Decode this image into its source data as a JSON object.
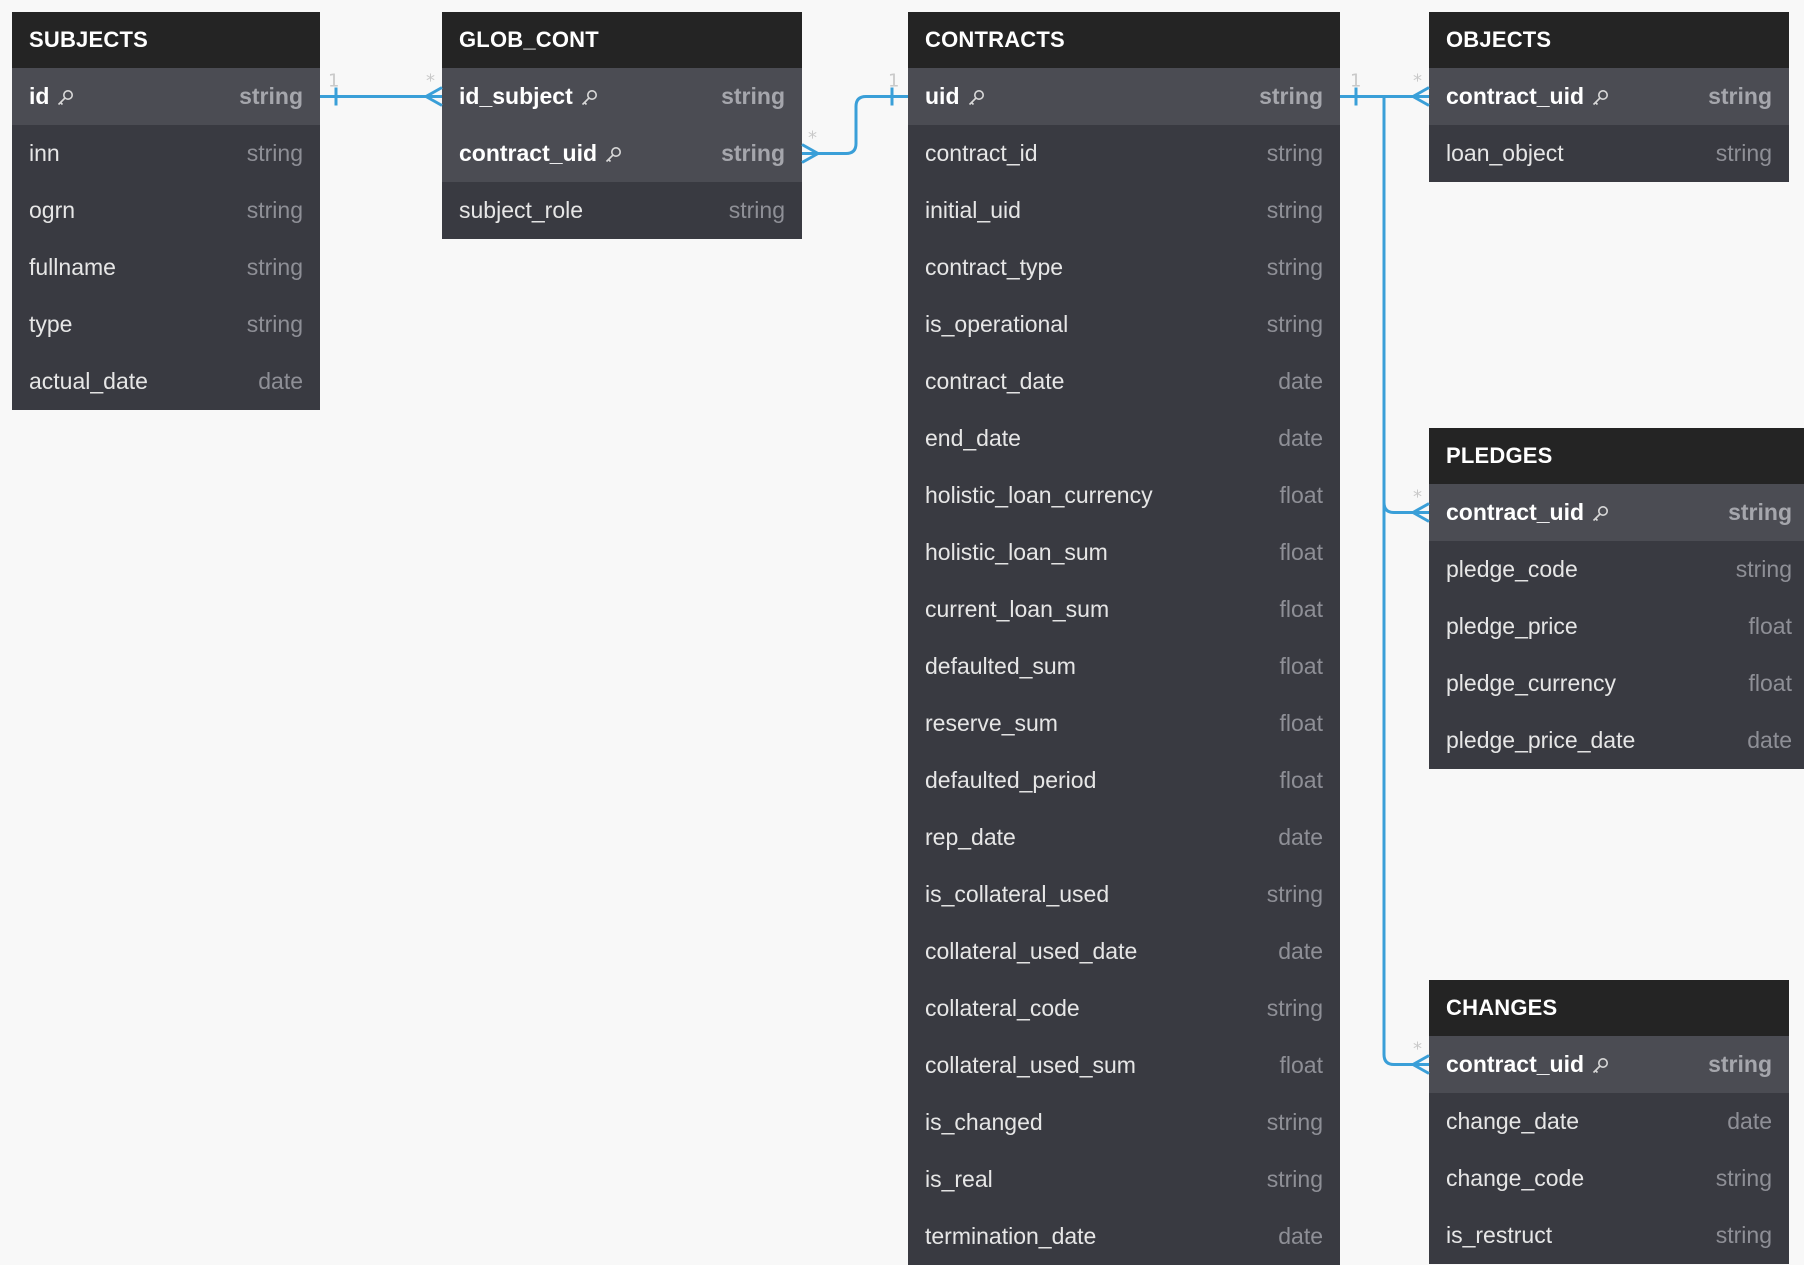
{
  "tables": [
    {
      "id": "subjects",
      "title": "SUBJECTS",
      "fields": [
        {
          "name": "id",
          "type": "string",
          "pk": true
        },
        {
          "name": "inn",
          "type": "string"
        },
        {
          "name": "ogrn",
          "type": "string"
        },
        {
          "name": "fullname",
          "type": "string"
        },
        {
          "name": "type",
          "type": "string"
        },
        {
          "name": "actual_date",
          "type": "date"
        }
      ]
    },
    {
      "id": "glob_cont",
      "title": "GLOB_CONT",
      "fields": [
        {
          "name": "id_subject",
          "type": "string",
          "pk": true
        },
        {
          "name": "contract_uid",
          "type": "string",
          "pk": true
        },
        {
          "name": "subject_role",
          "type": "string"
        }
      ]
    },
    {
      "id": "contracts",
      "title": "CONTRACTS",
      "fields": [
        {
          "name": "uid",
          "type": "string",
          "pk": true
        },
        {
          "name": "contract_id",
          "type": "string"
        },
        {
          "name": "initial_uid",
          "type": "string"
        },
        {
          "name": "contract_type",
          "type": "string"
        },
        {
          "name": "is_operational",
          "type": "string"
        },
        {
          "name": "contract_date",
          "type": "date"
        },
        {
          "name": "end_date",
          "type": "date"
        },
        {
          "name": "holistic_loan_currency",
          "type": "float"
        },
        {
          "name": "holistic_loan_sum",
          "type": "float"
        },
        {
          "name": "current_loan_sum",
          "type": "float"
        },
        {
          "name": "defaulted_sum",
          "type": "float"
        },
        {
          "name": "reserve_sum",
          "type": "float"
        },
        {
          "name": "defaulted_period",
          "type": "float"
        },
        {
          "name": "rep_date",
          "type": "date"
        },
        {
          "name": "is_collateral_used",
          "type": "string"
        },
        {
          "name": "collateral_used_date",
          "type": "date"
        },
        {
          "name": "collateral_code",
          "type": "string"
        },
        {
          "name": "collateral_used_sum",
          "type": "float"
        },
        {
          "name": "is_changed",
          "type": "string"
        },
        {
          "name": "is_real",
          "type": "string"
        },
        {
          "name": "termination_date",
          "type": "date"
        }
      ]
    },
    {
      "id": "objects",
      "title": "OBJECTS",
      "fields": [
        {
          "name": "contract_uid",
          "type": "string",
          "pk": true
        },
        {
          "name": "loan_object",
          "type": "string"
        }
      ]
    },
    {
      "id": "pledges",
      "title": "PLEDGES",
      "fields": [
        {
          "name": "contract_uid",
          "type": "string",
          "pk": true
        },
        {
          "name": "pledge_code",
          "type": "string"
        },
        {
          "name": "pledge_price",
          "type": "float"
        },
        {
          "name": "pledge_currency",
          "type": "float"
        },
        {
          "name": "pledge_price_date",
          "type": "date"
        }
      ]
    },
    {
      "id": "changes",
      "title": "CHANGES",
      "fields": [
        {
          "name": "contract_uid",
          "type": "string",
          "pk": true
        },
        {
          "name": "change_date",
          "type": "date"
        },
        {
          "name": "change_code",
          "type": "string"
        },
        {
          "name": "is_restruct",
          "type": "string"
        }
      ]
    }
  ],
  "relations": [
    {
      "from": "subjects.id",
      "to": "glob_cont.id_subject",
      "from_card": "1",
      "to_card": "*"
    },
    {
      "from": "contracts.uid",
      "to": "glob_cont.contract_uid",
      "from_card": "1",
      "to_card": "*"
    },
    {
      "from": "contracts.uid",
      "to": "objects.contract_uid",
      "from_card": "1",
      "to_card": "*"
    },
    {
      "from": "contracts.uid",
      "to": "pledges.contract_uid",
      "from_card": "1",
      "to_card": "*"
    },
    {
      "from": "contracts.uid",
      "to": "changes.contract_uid",
      "from_card": "1",
      "to_card": "*"
    }
  ],
  "colors": {
    "connector": "#3a9fd8",
    "header": "#242424",
    "body": "#393a41",
    "pk_row": "#4b4c53"
  }
}
